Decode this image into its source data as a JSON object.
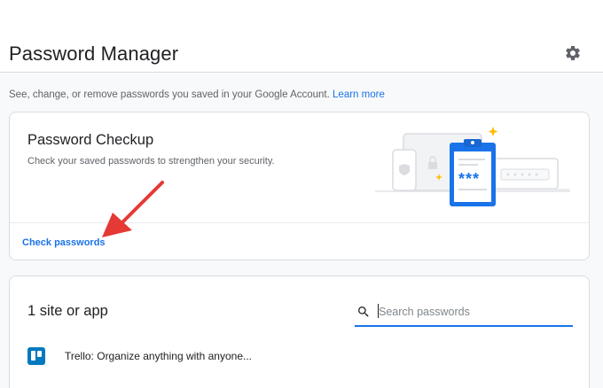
{
  "header": {
    "title": "Password Manager",
    "settings_icon": "gear-icon"
  },
  "intro": {
    "text": "See, change, or remove passwords you saved in your Google Account.",
    "learn_more": "Learn more"
  },
  "checkup": {
    "title": "Password Checkup",
    "description": "Check your saved passwords to strengthen your security.",
    "action": "Check passwords",
    "illustration_stars": "***"
  },
  "sites": {
    "count_label": "1 site or app",
    "search": {
      "placeholder": "Search passwords",
      "value": ""
    },
    "items": [
      {
        "name": "Trello: Organize anything with anyone...",
        "icon": "trello-icon"
      }
    ]
  },
  "colors": {
    "accent": "#1a73e8",
    "annotation_arrow": "#e53935",
    "trello": "#0079bf"
  }
}
